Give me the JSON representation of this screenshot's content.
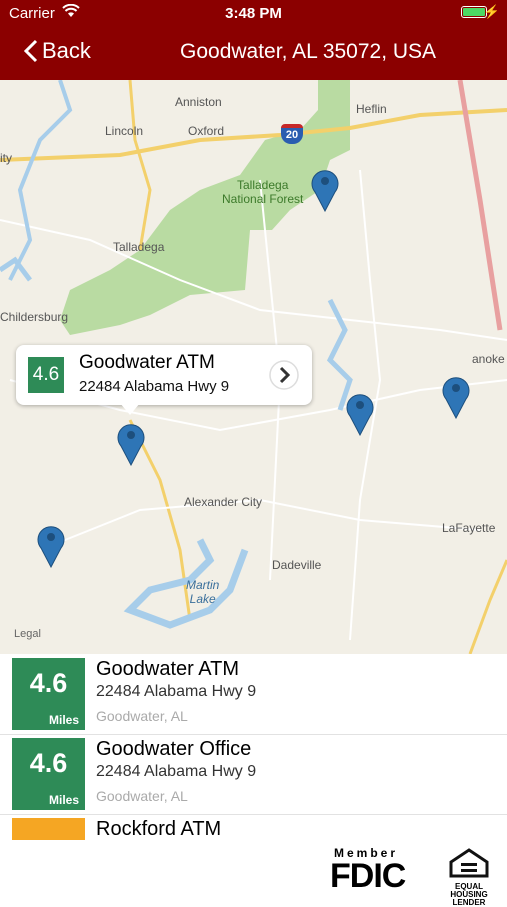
{
  "status": {
    "carrier": "Carrier",
    "time": "3:48 PM"
  },
  "nav": {
    "back_label": "Back",
    "title": "Goodwater, AL 35072, USA"
  },
  "map": {
    "places": {
      "anniston": "Anniston",
      "heflin": "Heflin",
      "lincoln": "Lincoln",
      "oxford": "Oxford",
      "interstate": "20",
      "city_partial": "ity",
      "forest": "Talladega\nNational Forest",
      "talladega": "Talladega",
      "childersburg": "Childersburg",
      "roanoke": "anoke",
      "alexander_city": "Alexander City",
      "lafayette": "LaFayette",
      "dadeville": "Dadeville",
      "martin_lake": "Martin\nLake"
    },
    "legal": "Legal",
    "callout": {
      "distance": "4.6",
      "title": "Goodwater ATM",
      "subtitle": "22484 Alabama Hwy 9"
    }
  },
  "list": [
    {
      "distance": "4.6",
      "unit": "Miles",
      "name": "Goodwater ATM",
      "address": "22484 Alabama Hwy 9",
      "city": "Goodwater, AL"
    },
    {
      "distance": "4.6",
      "unit": "Miles",
      "name": "Goodwater Office",
      "address": "22484 Alabama Hwy 9",
      "city": "Goodwater, AL"
    },
    {
      "name": "Rockford ATM"
    }
  ],
  "footer": {
    "member": "Member",
    "fdic": "FDIC",
    "lender_text": "EQUAL HOUSING\nLENDER"
  },
  "colors": {
    "brand": "#8b0000",
    "distance_badge": "#2e8b57",
    "accent_orange": "#f5a623",
    "pin": "#2e75b6"
  }
}
